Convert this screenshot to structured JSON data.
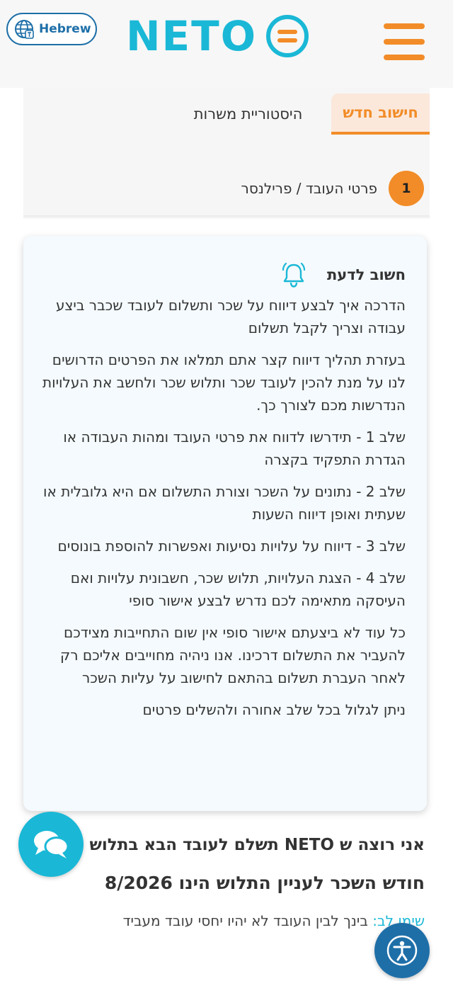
{
  "header": {
    "language_label": "Hebrew",
    "logo_text": "NETO",
    "icons": {
      "language": "globe-icon",
      "logo": "equals-circle-icon",
      "menu": "hamburger-menu-icon"
    },
    "colors": {
      "brand_cyan": "#1ab8d6",
      "accent_orange": "#f28c28",
      "blue": "#1e6fa8"
    }
  },
  "tabs": [
    {
      "label": "חישוב חדש",
      "active": true
    },
    {
      "label": "היסטוריית משרות",
      "active": false
    }
  ],
  "step": {
    "number": "1",
    "label": "פרטי העובד / פרילנסר"
  },
  "info_card": {
    "icon": "bell-icon",
    "title": "חשוב לדעת",
    "paragraphs": [
      "הדרכה איך לבצע דיווח על שכר ותשלום לעובד שכבר ביצע עבודה וצריך לקבל תשלום",
      "בעזרת תהליך דיווח קצר אתם תמלאו את הפרטים הדרושים לנו על מנת להכין לעובד שכר ותלוש שכר ולחשב את העלויות הנדרשות מכם לצורך כך.",
      "שלב 1 - תידרשו לדווח את פרטי העובד ומהות העבודה או הגדרת התפקיד בקצרה",
      "שלב 2 - נתונים על השכר וצורת התשלום אם היא גלובלית או שעתית ואופן דיווח השעות",
      "שלב 3 - דיווח על עלויות נסיעות ואפשרות להוספת בונוסים",
      "שלב 4 - הצגת העלויות, תלוש שכר, חשבונית עלויות ואם העיסקה מתאימה לכם נדרש לבצע אישור סופי",
      "כל עוד לא ביצעתם אישור סופי אין שום התחייבות מצידכם להעביר את התשלום דרכינו. אנו ניהיה מחוייבים אליכם רק לאחר העברת תשלום בהתאם לחישוב על עליות השכר",
      "ניתן לגלול בכל שלב אחורה ולהשלים פרטים"
    ]
  },
  "main": {
    "question": "אני רוצה ש NETO תשלם לעובד הבא בתלוש",
    "month_line": "חודש השכר לעניין התלוש הינו 8/2026",
    "note_prefix": "שימו לב:",
    "note_text": " בינך לבין העובד לא יהיו יחסי עובד מעביד"
  },
  "floating": {
    "chat_icon": "chat-bubbles-icon",
    "accessibility_icon": "accessibility-icon"
  }
}
